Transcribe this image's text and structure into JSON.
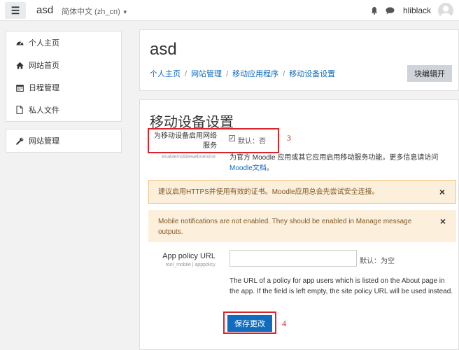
{
  "navbar": {
    "menu_icon": "hamburger-icon",
    "brand": "asd",
    "language": "简体中文 (zh_cn)",
    "username": "hliblack"
  },
  "sidebar": {
    "primary_items": [
      {
        "label": "个人主页",
        "icon": "dashboard-icon"
      },
      {
        "label": "网站首页",
        "icon": "home-icon"
      },
      {
        "label": "日程管理",
        "icon": "calendar-icon"
      },
      {
        "label": "私人文件",
        "icon": "file-icon"
      }
    ],
    "admin_item": {
      "label": "网站管理",
      "icon": "wrench-icon"
    }
  },
  "header": {
    "title": "asd",
    "breadcrumb": [
      "个人主页",
      "网站管理",
      "移动应用程序",
      "移动设备设置"
    ],
    "block_edit_button": "块编辑开"
  },
  "settings": {
    "title": "移动设备设置",
    "webservice": {
      "label": "为移动设备启用网络服务",
      "id": "enablemobilewebservice",
      "default": "默认：否",
      "checked": true,
      "desc_prefix": "为官方 Moodle 应用或其它应用启用移动服务功能。更多信息请访问",
      "desc_link": "Moodle文档",
      "desc_suffix": "。"
    },
    "alert_https": "建议启用HTTPS并使用有效的证书。Moodle应用总会先尝试安全连接。",
    "alert_notifications": "Mobile notifications are not enabled. They should be enabled in Manage message outputs.",
    "app_policy": {
      "label": "App policy URL",
      "id": "tool_mobile | apppolicy",
      "value": "",
      "default": "默认：为空",
      "desc": "The URL of a policy for app users which is listed on the About page in the app. If the field is left empty, the site policy URL will be used instead."
    },
    "save_button": "保存更改"
  },
  "annotations": {
    "first": "3",
    "second": "4"
  },
  "colors": {
    "link": "#0f6cbf",
    "primary_button": "#0f6cbf",
    "annotation_red": "#d9262c",
    "alert_bg": "#fcefdc"
  }
}
